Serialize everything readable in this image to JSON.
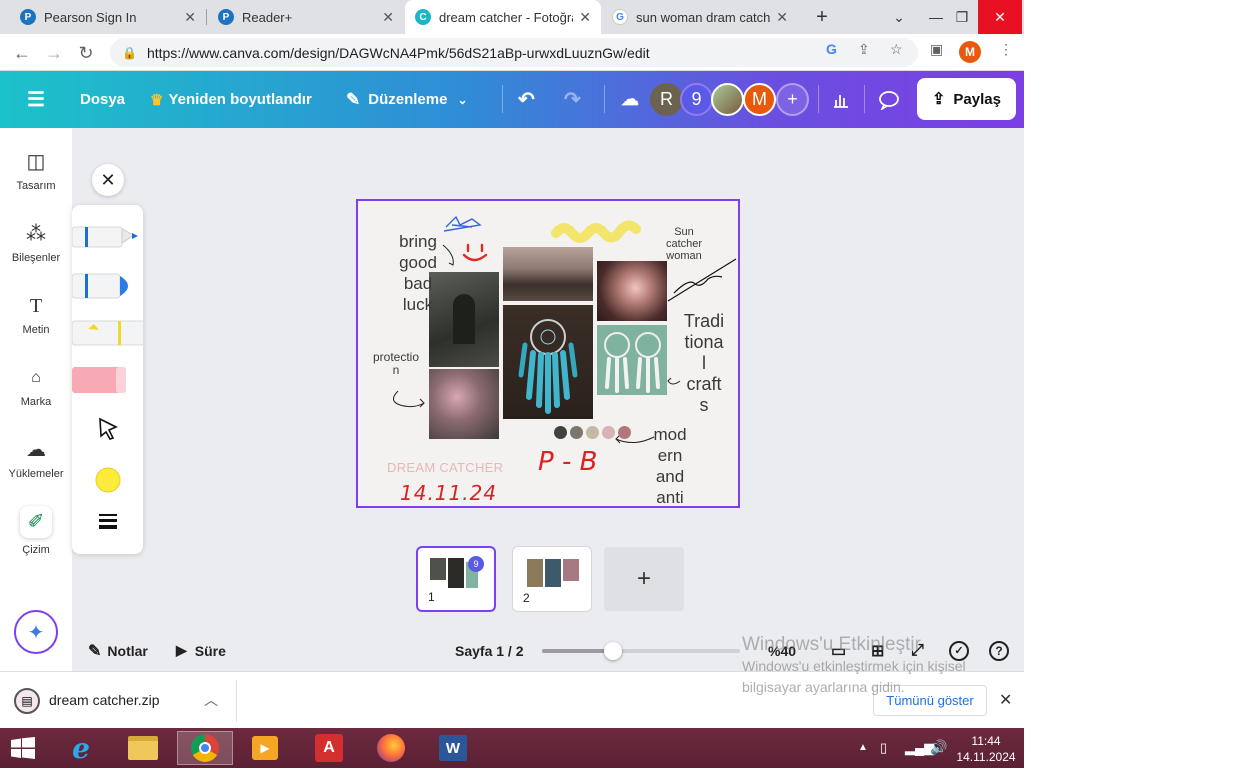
{
  "browser": {
    "tabs": [
      {
        "title": "Pearson Sign In",
        "favicon": "P"
      },
      {
        "title": "Reader+",
        "favicon": "P"
      },
      {
        "title": "dream catcher - Fotoğraf",
        "favicon": "C"
      },
      {
        "title": "sun woman dram catcher",
        "favicon": "G"
      }
    ],
    "new_tab": "+",
    "url": "https://www.canva.com/design/DAGWcNA4Pmk/56dS21aBp-urwxdLuuznGw/edit",
    "profile_initial": "M"
  },
  "canva_header": {
    "menu_label": "Dosya",
    "resize_label": "Yeniden boyutlandır",
    "edit_label": "Düzenleme",
    "collab_r": "R",
    "collab_count": "9",
    "collab_m": "M",
    "add": "+",
    "share_label": "Paylaş"
  },
  "left_rail": [
    {
      "label": "Tasarım",
      "icon": "design-icon"
    },
    {
      "label": "Bileşenler",
      "icon": "elements-icon"
    },
    {
      "label": "Metin",
      "icon": "text-icon"
    },
    {
      "label": "Marka",
      "icon": "brand-icon"
    },
    {
      "label": "Yüklemeler",
      "icon": "uploads-icon"
    },
    {
      "label": "Çizim",
      "icon": "draw-icon"
    }
  ],
  "design": {
    "bring": "bring",
    "good": "good",
    "bad": "bad",
    "luck": "luck",
    "sun_catcher": "Sun catcher woman",
    "traditional_1": "Tradi",
    "traditional_2": "tiona",
    "traditional_3": "l",
    "traditional_4": "craft",
    "traditional_5": "s",
    "protection_1": "protectio",
    "protection_2": "n",
    "modern_1": "mod",
    "modern_2": "ern",
    "modern_3": "and",
    "modern_4": "anti",
    "dream_catcher": "DREAM CATCHER",
    "handwritten_date": "14.11.24",
    "handwritten_initials": "P - B",
    "palette": [
      "#3f4340",
      "#7b776c",
      "#c4b8a3",
      "#d8b2b5",
      "#b37777"
    ]
  },
  "pages": {
    "thumb1": "1",
    "thumb1_badge": "9",
    "thumb2": "2",
    "add": "+"
  },
  "bottom_bar": {
    "notes": "Notlar",
    "timer": "Süre",
    "page_indicator": "Sayfa 1 / 2",
    "zoom": "%40",
    "zoom_fraction": 0.4,
    "help": "?"
  },
  "download": {
    "file": "dream catcher.zip",
    "show_all": "Tümünü göster"
  },
  "activation": {
    "title": "Windows'u Etkinleştir",
    "body_1": "Windows'u etkinleştirmek için kişisel",
    "body_2": "bilgisayar ayarlarına gidin."
  },
  "taskbar": {
    "time": "11:44",
    "date": "14.11.2024"
  },
  "colors": {
    "accent": "#7d3ff0",
    "canva_teal": "#1cc2c9",
    "taskbar": "#5b2034"
  }
}
